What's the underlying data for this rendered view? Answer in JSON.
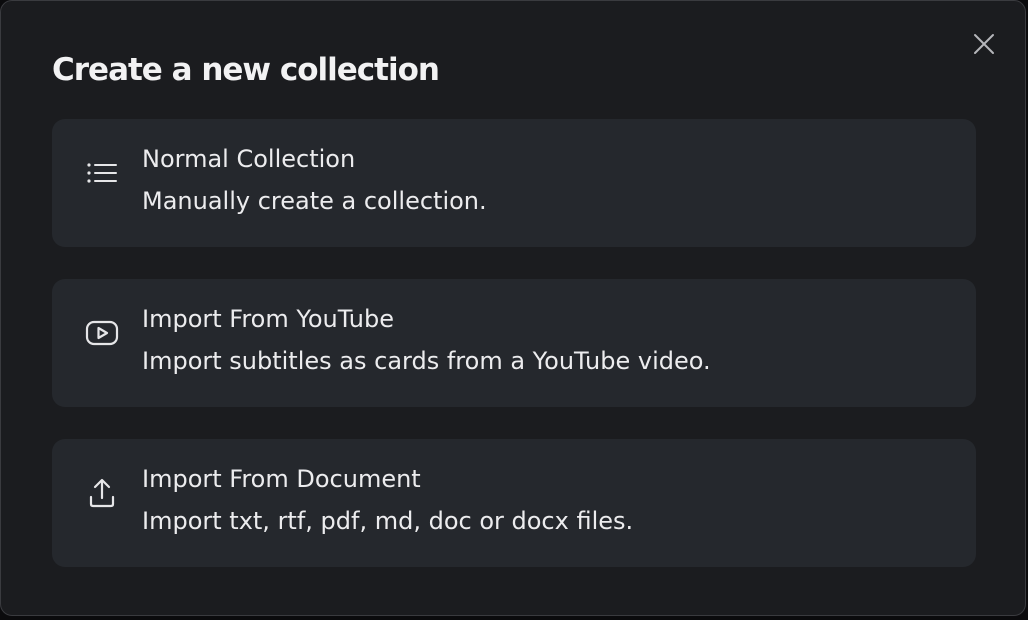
{
  "dialog": {
    "title": "Create a new collection",
    "close_icon": "close-icon"
  },
  "options": [
    {
      "icon": "list-icon",
      "title": "Normal Collection",
      "description": "Manually create a collection."
    },
    {
      "icon": "youtube-play-icon",
      "title": "Import From YouTube",
      "description": "Import subtitles as cards from a YouTube video."
    },
    {
      "icon": "upload-icon",
      "title": "Import From Document",
      "description": "Import txt, rtf, pdf, md, doc or docx files."
    }
  ],
  "colors": {
    "dialog_background": "#1b1c1f",
    "card_background": "#25282d",
    "text": "#ececee"
  }
}
